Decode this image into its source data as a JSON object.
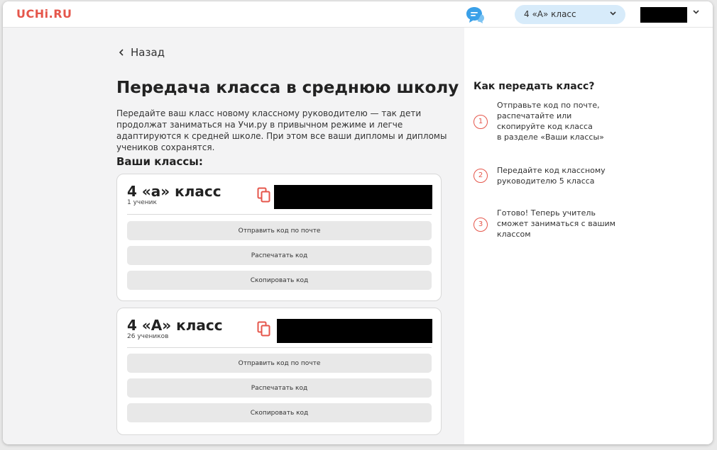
{
  "header": {
    "logo": "UCHi.RU",
    "class_selector": {
      "selected": "4 «А» класс"
    }
  },
  "nav": {
    "back_label": "Назад"
  },
  "page": {
    "title": "Передача класса в среднюю школу",
    "intro": "Передайте ваш класс новому классному руководителю — так дети продолжат заниматься на Учи.ру в привычном режиме и легче адаптируются к средней школе. При этом все ваши дипломы и дипломы учеников сохранятся.",
    "section_title": "Ваши классы:"
  },
  "classes": [
    {
      "name": "4 «а» класс",
      "students": "1 ученик",
      "buttons": [
        "Отправить код по почте",
        "Распечатать код",
        "Скопировать код"
      ]
    },
    {
      "name": "4 «А» класс",
      "students": "26 учеников",
      "buttons": [
        "Отправить код по почте",
        "Распечатать код",
        "Скопировать код"
      ]
    }
  ],
  "help": {
    "title": "Как передать класс?",
    "steps": [
      {
        "num": "1",
        "text": "Отправьте код по почте,\nраспечатайте или\nскопируйте код класса\nв разделе «Ваши классы»"
      },
      {
        "num": "2",
        "text": "Передайте код классному\nруководителю 5 класса"
      },
      {
        "num": "3",
        "text": "Готово! Теперь учитель\nсможет заниматься с вашим\nклассом"
      }
    ]
  },
  "colors": {
    "brand": "#e5564b",
    "selector_bg": "#d7ebfa",
    "chat_icon": "#3aa0e8",
    "button_bg": "#e8e8e8"
  }
}
